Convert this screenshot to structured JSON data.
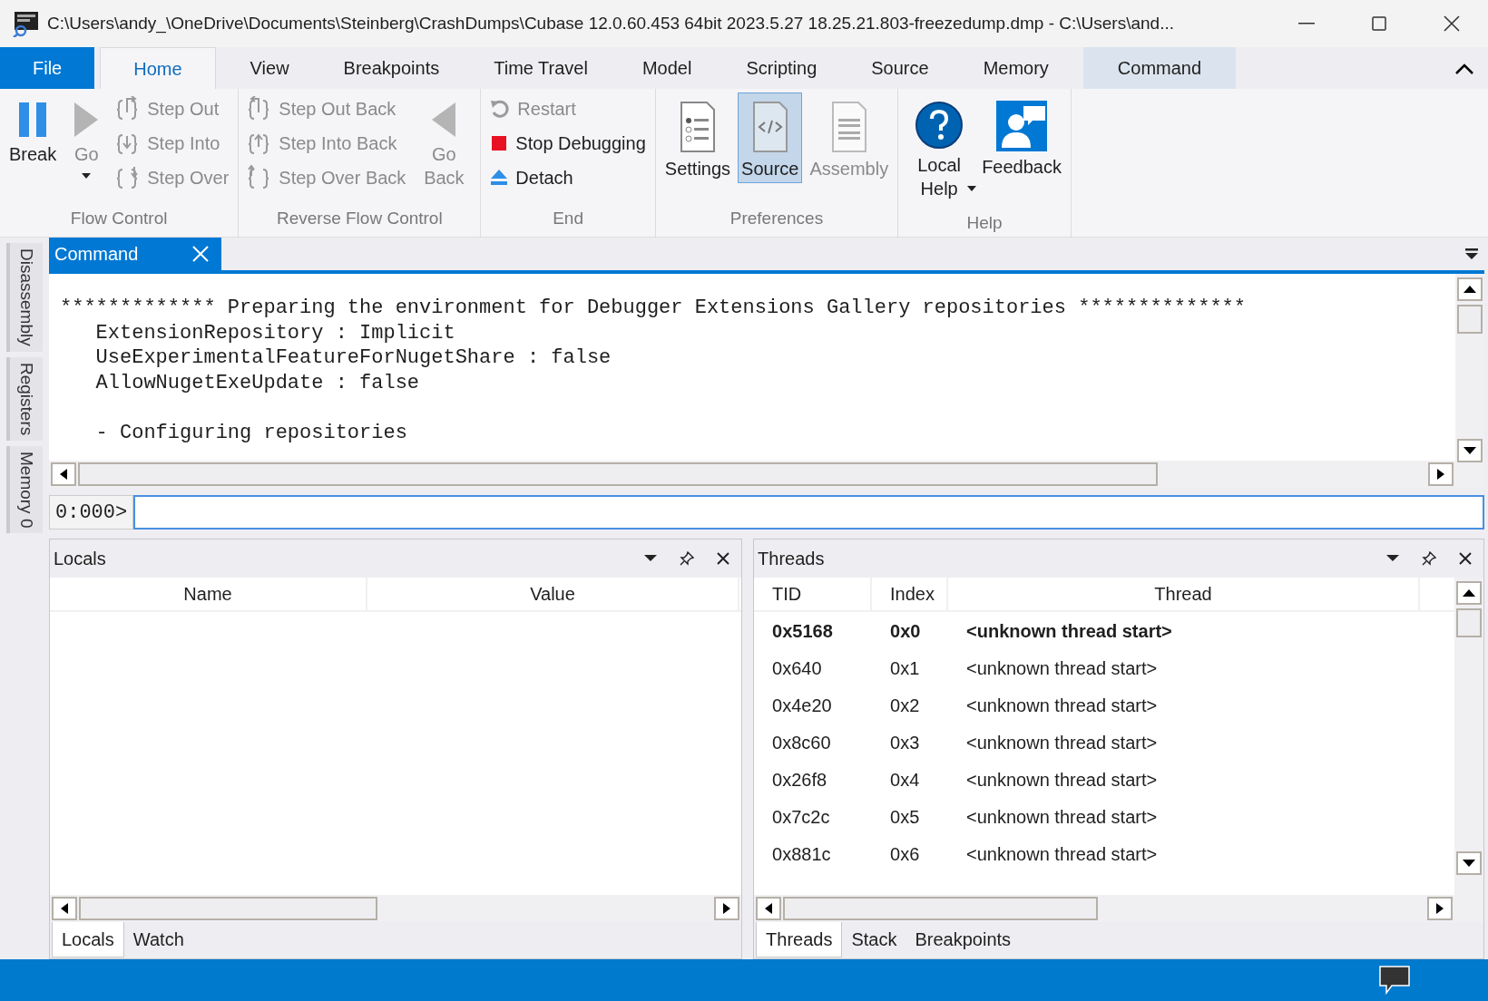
{
  "window": {
    "title": "C:\\Users\\andy_\\OneDrive\\Documents\\Steinberg\\CrashDumps\\Cubase 12.0.60.453 64bit 2023.5.27 18.25.21.803-freezedump.dmp - C:\\Users\\and..."
  },
  "ribbon": {
    "tabs": [
      {
        "label": "File",
        "kind": "file",
        "selected": false
      },
      {
        "label": "Home",
        "kind": "normal",
        "selected": true
      },
      {
        "label": "View",
        "kind": "normal",
        "selected": false
      },
      {
        "label": "Breakpoints",
        "kind": "normal",
        "selected": false
      },
      {
        "label": "Time Travel",
        "kind": "normal",
        "selected": false
      },
      {
        "label": "Model",
        "kind": "normal",
        "selected": false
      },
      {
        "label": "Scripting",
        "kind": "normal",
        "selected": false
      },
      {
        "label": "Source",
        "kind": "normal",
        "selected": false
      },
      {
        "label": "Memory",
        "kind": "normal",
        "selected": false
      },
      {
        "label": "Command",
        "kind": "contextual",
        "selected": false
      }
    ],
    "groups": [
      {
        "label": "Flow Control",
        "items": [
          {
            "kind": "large",
            "label": "Break",
            "disabled": false
          },
          {
            "kind": "large",
            "label": "Go",
            "disabled": true,
            "dropdown": true
          },
          {
            "kind": "small",
            "label": "Step Out",
            "disabled": true
          },
          {
            "kind": "small",
            "label": "Step Into",
            "disabled": true
          },
          {
            "kind": "small",
            "label": "Step Over",
            "disabled": true
          }
        ]
      },
      {
        "label": "Reverse Flow Control",
        "items": [
          {
            "kind": "small",
            "label": "Step Out Back",
            "disabled": true
          },
          {
            "kind": "small",
            "label": "Step Into Back",
            "disabled": true
          },
          {
            "kind": "small",
            "label": "Step Over Back",
            "disabled": true
          },
          {
            "kind": "large",
            "label": "Go Back",
            "disabled": true
          }
        ]
      },
      {
        "label": "End",
        "items": [
          {
            "kind": "small",
            "label": "Restart",
            "disabled": true
          },
          {
            "kind": "small",
            "label": "Stop Debugging",
            "disabled": false
          },
          {
            "kind": "small",
            "label": "Detach",
            "disabled": false
          }
        ]
      },
      {
        "label": "Preferences",
        "items": [
          {
            "kind": "large",
            "label": "Settings",
            "disabled": false,
            "selected": false
          },
          {
            "kind": "large",
            "label": "Source",
            "disabled": false,
            "selected": true
          },
          {
            "kind": "large",
            "label": "Assembly",
            "disabled": true,
            "selected": false
          }
        ]
      },
      {
        "label": "Help",
        "items": [
          {
            "kind": "large",
            "label": "Local Help",
            "disabled": false,
            "dropdown": true
          },
          {
            "kind": "large",
            "label": "Feedback",
            "disabled": false
          }
        ]
      }
    ]
  },
  "side_tabs": [
    "Disassembly",
    "Registers",
    "Memory 0"
  ],
  "document_tab": {
    "label": "Command",
    "selected": true
  },
  "command_output": [
    [
      "************* Preparing the environment for Debugger Extensions Gallery repositories **************",
      "   ExtensionRepository : Implicit",
      "   UseExperimentalFeatureForNugetShare : false",
      "   AllowNugetExeUpdate : false"
    ],
    [
      "   - Configuring repositories"
    ]
  ],
  "command_prompt": "0:000>",
  "locals_panel": {
    "title": "Locals",
    "columns": [
      "Name",
      "Value"
    ],
    "tabs": [
      {
        "label": "Locals",
        "selected": true
      },
      {
        "label": "Watch",
        "selected": false
      }
    ]
  },
  "threads_panel": {
    "title": "Threads",
    "columns": [
      "TID",
      "Index",
      "Thread"
    ],
    "rows": [
      {
        "tid": "0x5168",
        "index": "0x0",
        "thread": "<unknown thread start>",
        "current": true
      },
      {
        "tid": "0x640",
        "index": "0x1",
        "thread": "<unknown thread start>",
        "current": false
      },
      {
        "tid": "0x4e20",
        "index": "0x2",
        "thread": "<unknown thread start>",
        "current": false
      },
      {
        "tid": "0x8c60",
        "index": "0x3",
        "thread": "<unknown thread start>",
        "current": false
      },
      {
        "tid": "0x26f8",
        "index": "0x4",
        "thread": "<unknown thread start>",
        "current": false
      },
      {
        "tid": "0x7c2c",
        "index": "0x5",
        "thread": "<unknown thread start>",
        "current": false
      },
      {
        "tid": "0x881c",
        "index": "0x6",
        "thread": "<unknown thread start>",
        "current": false
      }
    ],
    "tabs": [
      {
        "label": "Threads",
        "selected": true
      },
      {
        "label": "Stack",
        "selected": false
      },
      {
        "label": "Breakpoints",
        "selected": false
      }
    ]
  }
}
